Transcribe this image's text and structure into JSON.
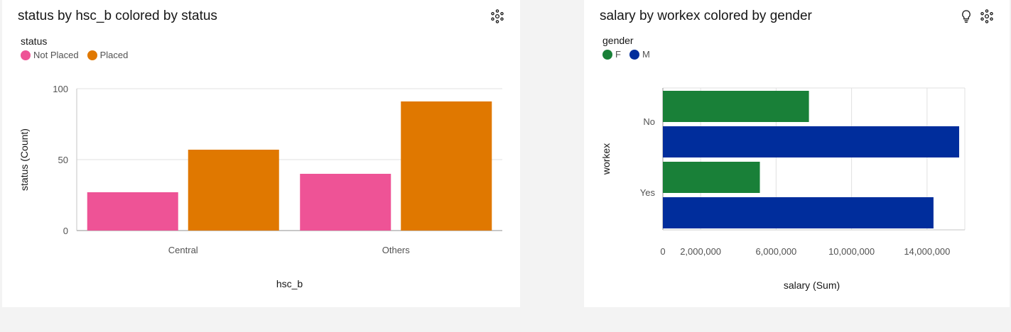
{
  "theme": {
    "not_placed": "#ee5396",
    "placed": "#e07800",
    "female": "#198038",
    "male": "#002d9c"
  },
  "icons": [
    "chart-settings-icon",
    "lightbulb-icon"
  ],
  "left_card": {
    "title": "status by hsc_b colored by status",
    "legend_title": "status",
    "legend": [
      "Not Placed",
      "Placed"
    ]
  },
  "right_card": {
    "title": "salary by workex colored by gender",
    "legend_title": "gender",
    "legend": [
      "F",
      "M"
    ]
  },
  "chart_data": [
    {
      "type": "bar",
      "orientation": "vertical",
      "title": "status by hsc_b colored by status",
      "xlabel": "hsc_b",
      "ylabel": "status (Count)",
      "categories": [
        "Central",
        "Others"
      ],
      "series": [
        {
          "name": "Not Placed",
          "values": [
            27,
            40
          ]
        },
        {
          "name": "Placed",
          "values": [
            57,
            91
          ]
        }
      ],
      "ylim": [
        0,
        100
      ],
      "yticks": [
        0,
        50,
        100
      ],
      "grid": true,
      "legend_position": "top-left"
    },
    {
      "type": "bar",
      "orientation": "horizontal",
      "title": "salary by workex colored by gender",
      "xlabel": "salary (Sum)",
      "ylabel": "workex",
      "categories": [
        "No",
        "Yes"
      ],
      "series": [
        {
          "name": "F",
          "values": [
            7740000,
            5140000
          ]
        },
        {
          "name": "M",
          "values": [
            15700000,
            14340000
          ]
        }
      ],
      "xlim": [
        0,
        16000000
      ],
      "xticks": [
        0,
        2000000,
        6000000,
        10000000,
        14000000
      ],
      "xtick_labels": [
        "0",
        "2,000,000",
        "6,000,000",
        "10,000,000",
        "14,000,000"
      ],
      "grid": true,
      "legend_position": "top-left"
    }
  ]
}
